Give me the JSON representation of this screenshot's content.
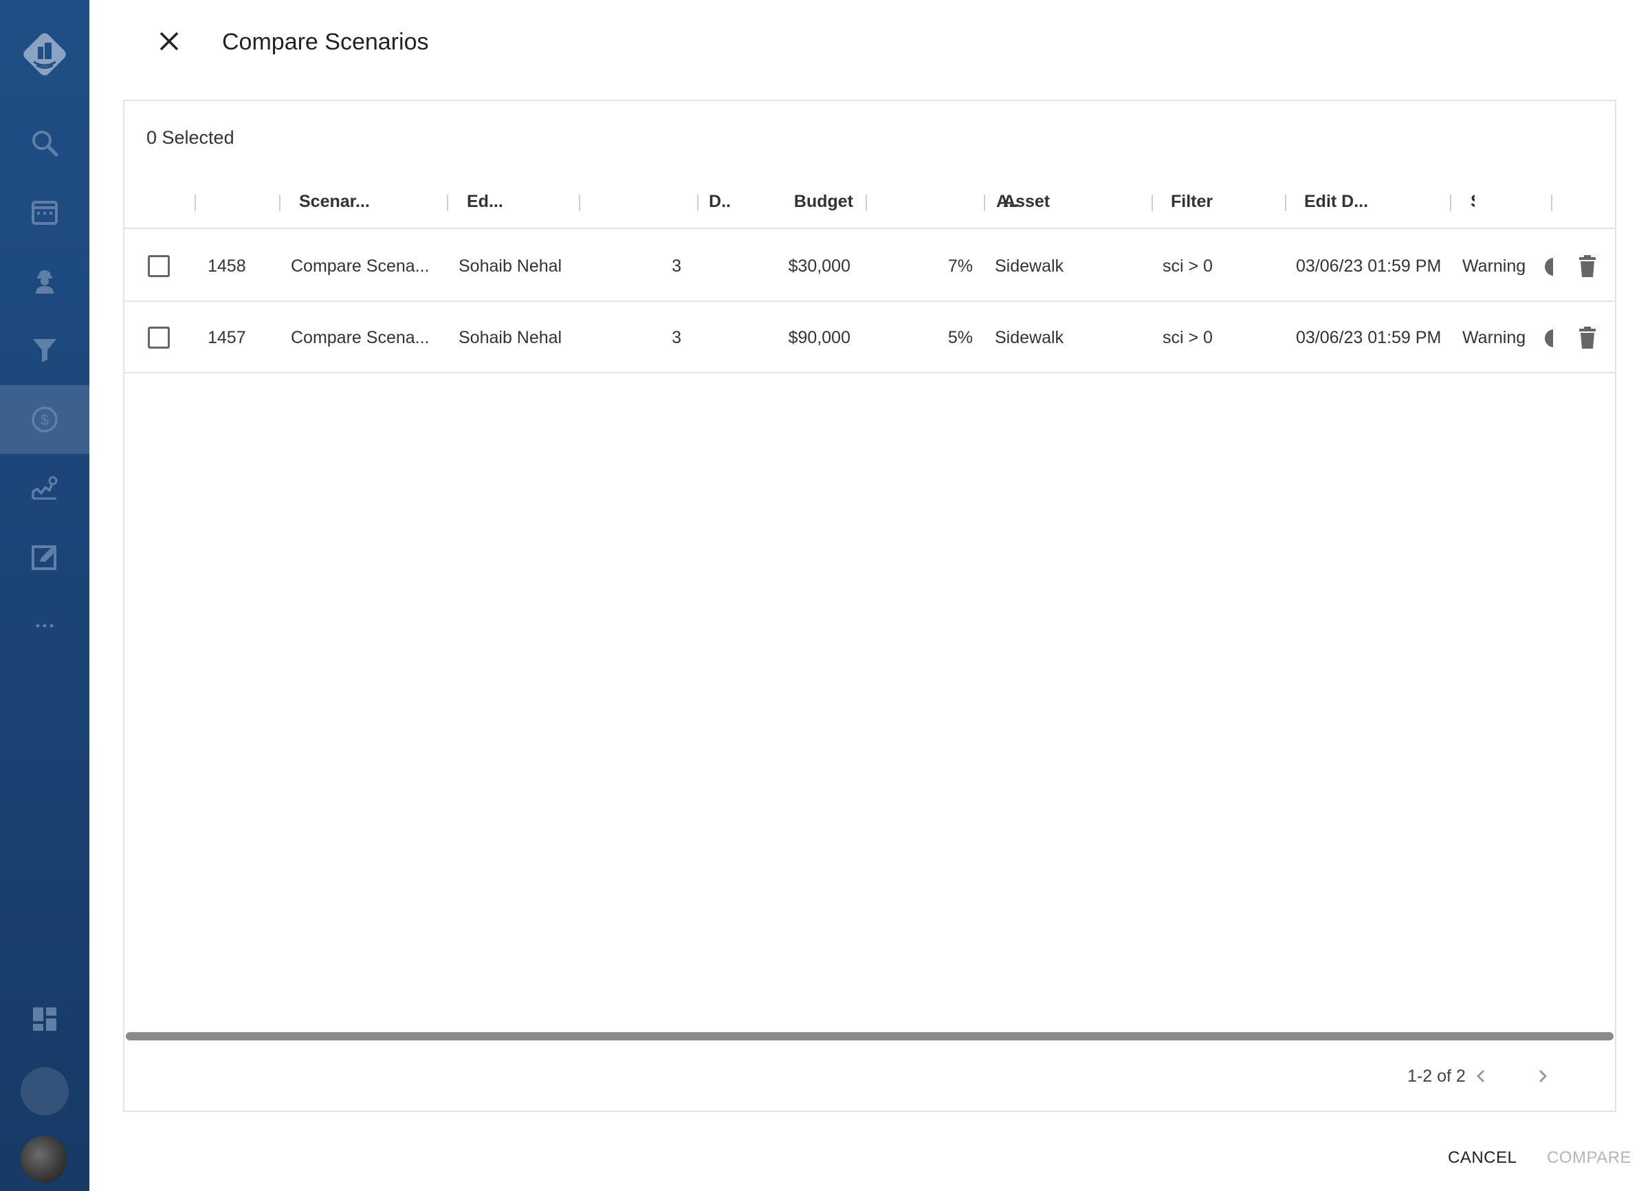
{
  "sidebar": {
    "items": [
      {
        "icon": "search-icon"
      },
      {
        "icon": "calendar-icon"
      },
      {
        "icon": "worker-icon"
      },
      {
        "icon": "filter-icon"
      },
      {
        "icon": "dollar-icon",
        "active": true
      },
      {
        "icon": "analytics-icon"
      },
      {
        "icon": "edit-icon"
      },
      {
        "icon": "more-icon"
      }
    ],
    "bottom": [
      {
        "icon": "dashboard-icon"
      }
    ]
  },
  "dialog": {
    "title": "Compare Scenarios",
    "selected_label": "0 Selected",
    "columns": [
      "",
      "Scenar...",
      "Ed...",
      "D..",
      "Budget",
      "A..",
      "Asset",
      "Filter",
      "Edit D...",
      "S"
    ],
    "rows": [
      {
        "id": "1458",
        "scenario": "Compare Scena...",
        "editor": "Sohaib Nehal",
        "d": "3",
        "budget": "$30,000",
        "a": "7%",
        "asset": "Sidewalk",
        "filter": "sci > 0",
        "edit_date": "03/06/23 01:59 PM",
        "status": "Warning"
      },
      {
        "id": "1457",
        "scenario": "Compare Scena...",
        "editor": "Sohaib Nehal",
        "d": "3",
        "budget": "$90,000",
        "a": "5%",
        "asset": "Sidewalk",
        "filter": "sci > 0",
        "edit_date": "03/06/23 01:59 PM",
        "status": "Warning"
      }
    ],
    "pagination": "1-2 of 2",
    "cancel_label": "CANCEL",
    "compare_label": "COMPARE"
  }
}
